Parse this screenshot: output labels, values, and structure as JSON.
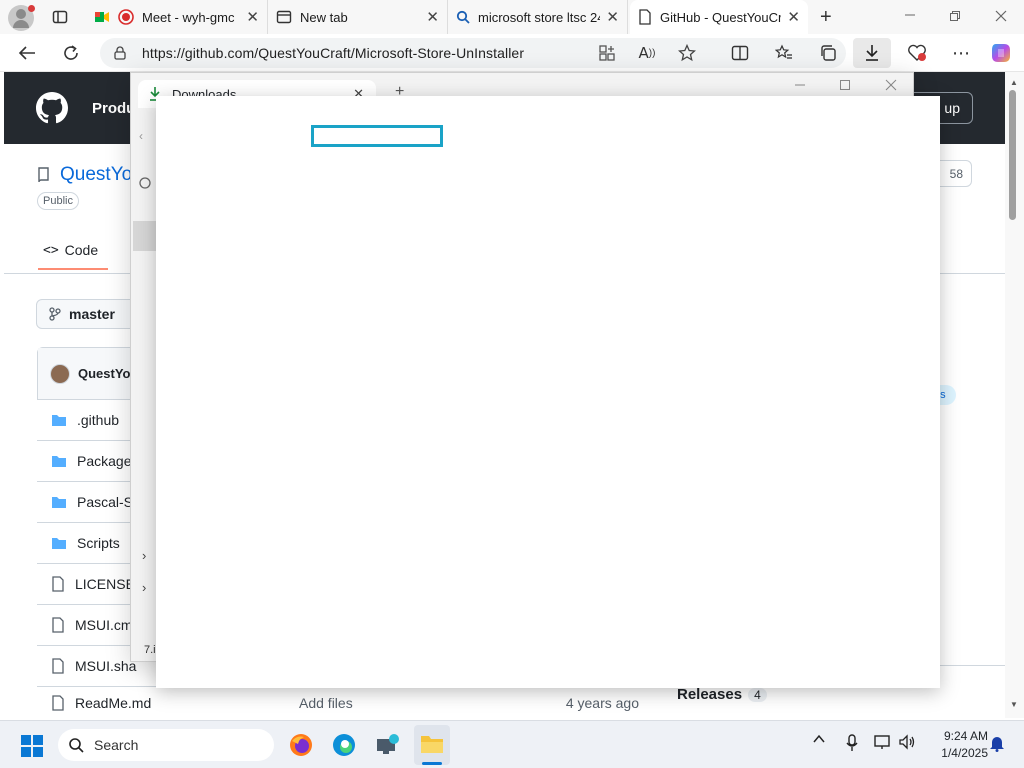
{
  "browser": {
    "tabs": [
      {
        "title": "Meet - wyh-gmc",
        "close": "✕"
      },
      {
        "title": "New tab",
        "close": "✕"
      },
      {
        "title": "microsoft store ltsc 24",
        "close": "✕"
      },
      {
        "title": "GitHub - QuestYouCraf",
        "close": "✕"
      }
    ],
    "new_tab": "+",
    "url": "https://github.com/QuestYouCraft/Microsoft-Store-UnInstaller"
  },
  "github": {
    "nav_product": "Produ",
    "signup": "up",
    "repo_owner": "QuestYo",
    "visibility": "Public",
    "tab_code": "Code",
    "star_count": "58",
    "branch": "master",
    "commit_author": "QuestYo",
    "topic_tag": "ns",
    "files": [
      {
        "name": ".github",
        "type": "folder"
      },
      {
        "name": "Package",
        "type": "folder"
      },
      {
        "name": "Pascal-S",
        "type": "folder"
      },
      {
        "name": "Scripts",
        "type": "folder"
      },
      {
        "name": "LICENSE",
        "type": "file"
      },
      {
        "name": "MSUI.cm",
        "type": "file"
      },
      {
        "name": "MSUI.sha",
        "type": "file"
      },
      {
        "name": "ReadMe.md",
        "type": "file",
        "message": "Add files",
        "age": "4 years ago"
      }
    ],
    "releases_label": "Releases",
    "releases_count": "4"
  },
  "downloads_window": {
    "tab_title": "Downloads",
    "tab_close": "✕",
    "new_tab": "+",
    "status_fragment": "7.i"
  },
  "taskbar": {
    "search_label": "Search",
    "time": "9:24 AM",
    "date": "1/4/2025"
  },
  "colors": {
    "github_header": "#24292f",
    "focus_outline": "#1aa3c7",
    "code_tab_underline": "#fd8c73",
    "folder": "#54aeff"
  }
}
